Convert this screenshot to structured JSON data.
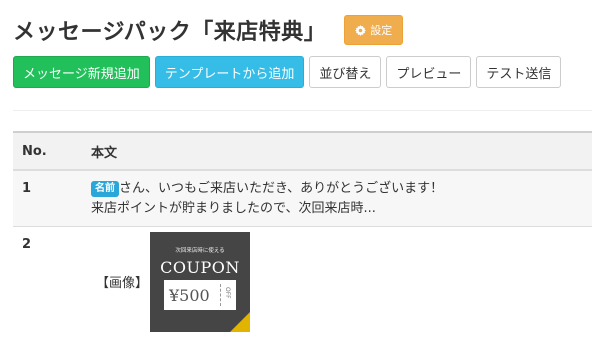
{
  "header": {
    "title": "メッセージパック「来店特典」",
    "settings_label": "設定"
  },
  "toolbar": {
    "new_message": "メッセージ新規追加",
    "from_template": "テンプレートから追加",
    "sort": "並び替え",
    "preview": "プレビュー",
    "test_send": "テスト送信"
  },
  "table": {
    "headers": {
      "no": "No.",
      "body": "本文"
    },
    "rows": [
      {
        "no": "1",
        "name_badge": "名前",
        "line1": "さん、いつもご来店いただき、ありがとうございます！",
        "line2": "来店ポイントが貯まりましたので、次回来店時..."
      },
      {
        "no": "2",
        "image_label": "【画像】",
        "coupon": {
          "subtitle": "次回来店時に使える",
          "title": "COUPON",
          "amount": "¥500",
          "off": "OFF"
        }
      }
    ]
  },
  "colors": {
    "settings_bg": "#f0ad4e",
    "green_btn": "#22c05a",
    "cyan_btn": "#35bde8",
    "badge": "#2aa7d8"
  },
  "icons": {
    "settings": "gear-icon"
  }
}
